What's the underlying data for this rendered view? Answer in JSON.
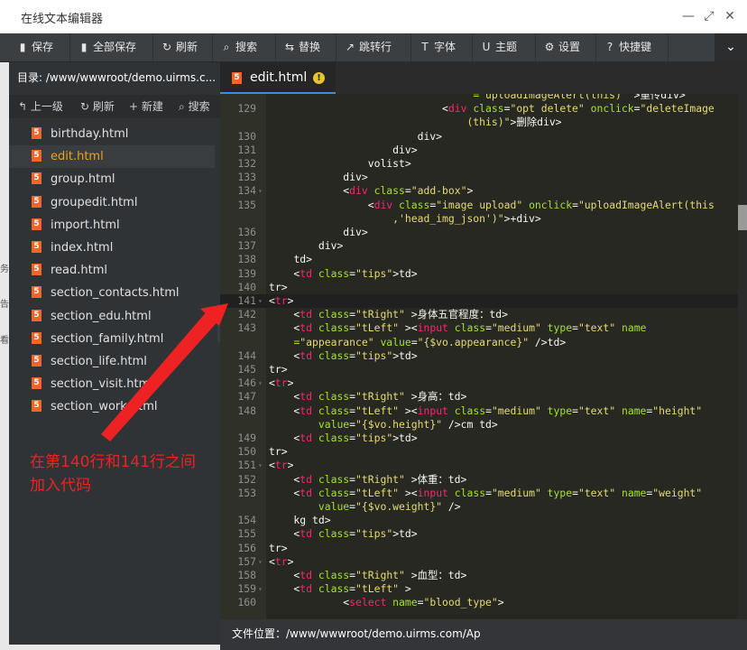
{
  "window": {
    "title": "在线文本编辑器",
    "minimize": "—",
    "maximize": "⤢",
    "close": "✕"
  },
  "toolbar": [
    {
      "label": "保存",
      "icon": "save-icon",
      "glyph": "▮"
    },
    {
      "label": "全部保存",
      "icon": "save-all-icon",
      "glyph": "▮"
    },
    {
      "label": "刷新",
      "icon": "refresh-icon",
      "glyph": "↻"
    },
    {
      "label": "搜索",
      "icon": "search-icon",
      "glyph": "⌕"
    },
    {
      "label": "替换",
      "icon": "replace-icon",
      "glyph": "⇆"
    },
    {
      "label": "跳转行",
      "icon": "goto-line-icon",
      "glyph": "↗"
    },
    {
      "label": "字体",
      "icon": "font-icon",
      "glyph": "T"
    },
    {
      "label": "主题",
      "icon": "theme-icon",
      "glyph": "U"
    },
    {
      "label": "设置",
      "icon": "settings-icon",
      "glyph": "⚙"
    },
    {
      "label": "快捷键",
      "icon": "shortcut-icon",
      "glyph": "?"
    }
  ],
  "toolbar_more": "⌄",
  "sidebar": {
    "directory": "目录: /www/wwwroot/demo.uirms.c...",
    "tools": [
      {
        "label": "上一级",
        "glyph": "↰"
      },
      {
        "label": "刷新",
        "glyph": "↻"
      },
      {
        "label": "新建",
        "glyph": "+"
      },
      {
        "label": "搜索",
        "glyph": "⌕"
      }
    ],
    "files": [
      "birthday.html",
      "edit.html",
      "group.html",
      "groupedit.html",
      "import.html",
      "index.html",
      "read.html",
      "section_contacts.html",
      "section_edu.html",
      "section_family.html",
      "section_life.html",
      "section_visit.html",
      "section_work.html"
    ],
    "active_file": "edit.html"
  },
  "editor": {
    "tab_name": "edit.html",
    "tab_warning": "!",
    "lines": [
      {
        "n": "",
        "fold": false,
        "html": "                                 <span class=\"a\">=</span><span class=\"s\">\"uploadImageAlert(this)\"</span> >重传</<span class=\"t\">div</span>>"
      },
      {
        "n": "129",
        "fold": false,
        "html": "                            <<span class=\"t\">div</span> <span class=\"a\">class</span>=<span class=\"s\">\"opt delete\"</span> <span class=\"a\">onclick</span>=<span class=\"s\">\"deleteImage</span>"
      },
      {
        "n": "",
        "fold": false,
        "html": "                                <span class=\"s\">(this)\"</span>>删除</<span class=\"t\">div</span>>"
      },
      {
        "n": "130",
        "fold": false,
        "html": "                        </<span class=\"t\">div</span>>"
      },
      {
        "n": "131",
        "fold": false,
        "html": "                    </<span class=\"t\">div</span>>"
      },
      {
        "n": "132",
        "fold": false,
        "html": "                </<span class=\"t\">volist</span>>"
      },
      {
        "n": "133",
        "fold": false,
        "html": "            </<span class=\"t\">div</span>>"
      },
      {
        "n": "134",
        "fold": true,
        "html": "            <<span class=\"t\">div</span> <span class=\"a\">class</span>=<span class=\"s\">\"add-box\"</span>>"
      },
      {
        "n": "135",
        "fold": false,
        "html": "                <<span class=\"t\">div</span> <span class=\"a\">class</span>=<span class=\"s\">\"image upload\"</span> <span class=\"a\">onclick</span>=<span class=\"s\">\"uploadImageAlert(this</span>"
      },
      {
        "n": "",
        "fold": false,
        "html": "                    <span class=\"s\">,'head_img_json')\"</span>>+</<span class=\"t\">div</span>>"
      },
      {
        "n": "136",
        "fold": false,
        "html": "            </<span class=\"t\">div</span>>"
      },
      {
        "n": "137",
        "fold": false,
        "html": "        </<span class=\"t\">div</span>>"
      },
      {
        "n": "138",
        "fold": false,
        "html": "    </<span class=\"t\">td</span>>"
      },
      {
        "n": "139",
        "fold": false,
        "html": "    <<span class=\"t\">td</span> <span class=\"a\">class</span>=<span class=\"s\">\"tips\"</span>></<span class=\"t\">td</span>>"
      },
      {
        "n": "140",
        "fold": false,
        "html": "</<span class=\"t\">tr</span>>"
      },
      {
        "n": "141",
        "fold": true,
        "cur": true,
        "html": "<<span class=\"t\">tr</span>>"
      },
      {
        "n": "142",
        "fold": false,
        "html": "    <<span class=\"t\">td</span> <span class=\"a\">class</span>=<span class=\"s\">\"tRight\"</span> >身体五官程度：</<span class=\"t\">td</span>>"
      },
      {
        "n": "143",
        "fold": false,
        "html": "    <<span class=\"t\">td</span> <span class=\"a\">class</span>=<span class=\"s\">\"tLeft\"</span> ><<span class=\"t\">input</span> <span class=\"a\">class</span>=<span class=\"s\">\"medium\"</span> <span class=\"a\">type</span>=<span class=\"s\">\"text\"</span> <span class=\"a\">name</span>"
      },
      {
        "n": "",
        "fold": false,
        "html": "    <span class=\"a\">=</span><span class=\"s\">\"appearance\"</span> <span class=\"a\">value</span>=<span class=\"s\">\"{$vo.appearance}\"</span> /></<span class=\"t\">td</span>>"
      },
      {
        "n": "144",
        "fold": false,
        "html": "    <<span class=\"t\">td</span> <span class=\"a\">class</span>=<span class=\"s\">\"tips\"</span>></<span class=\"t\">td</span>>"
      },
      {
        "n": "145",
        "fold": false,
        "html": "</<span class=\"t\">tr</span>>"
      },
      {
        "n": "146",
        "fold": true,
        "html": "<<span class=\"t\">tr</span>>"
      },
      {
        "n": "147",
        "fold": false,
        "html": "    <<span class=\"t\">td</span> <span class=\"a\">class</span>=<span class=\"s\">\"tRight\"</span> >身高：</<span class=\"t\">td</span>>"
      },
      {
        "n": "148",
        "fold": false,
        "html": "    <<span class=\"t\">td</span> <span class=\"a\">class</span>=<span class=\"s\">\"tLeft\"</span> ><<span class=\"t\">input</span> <span class=\"a\">class</span>=<span class=\"s\">\"medium\"</span> <span class=\"a\">type</span>=<span class=\"s\">\"text\"</span> <span class=\"a\">name</span>=<span class=\"s\">\"height\"</span>"
      },
      {
        "n": "",
        "fold": false,
        "html": "        <span class=\"a\">value</span>=<span class=\"s\">\"{$vo.height}\"</span> />cm </<span class=\"t\">td</span>>"
      },
      {
        "n": "149",
        "fold": false,
        "html": "    <<span class=\"t\">td</span> <span class=\"a\">class</span>=<span class=\"s\">\"tips\"</span>></<span class=\"t\">td</span>>"
      },
      {
        "n": "150",
        "fold": false,
        "html": "</<span class=\"t\">tr</span>>"
      },
      {
        "n": "151",
        "fold": true,
        "html": "<<span class=\"t\">tr</span>>"
      },
      {
        "n": "152",
        "fold": false,
        "html": "    <<span class=\"t\">td</span> <span class=\"a\">class</span>=<span class=\"s\">\"tRight\"</span> >体重：</<span class=\"t\">td</span>>"
      },
      {
        "n": "153",
        "fold": false,
        "html": "    <<span class=\"t\">td</span> <span class=\"a\">class</span>=<span class=\"s\">\"tLeft\"</span> ><<span class=\"t\">input</span> <span class=\"a\">class</span>=<span class=\"s\">\"medium\"</span> <span class=\"a\">type</span>=<span class=\"s\">\"text\"</span> <span class=\"a\">name</span>=<span class=\"s\">\"weight\"</span>"
      },
      {
        "n": "",
        "fold": false,
        "html": "        <span class=\"a\">value</span>=<span class=\"s\">\"{$vo.weight}\"</span> />"
      },
      {
        "n": "154",
        "fold": false,
        "html": "    kg </<span class=\"t\">td</span>>"
      },
      {
        "n": "155",
        "fold": false,
        "html": "    <<span class=\"t\">td</span> <span class=\"a\">class</span>=<span class=\"s\">\"tips\"</span>></<span class=\"t\">td</span>>"
      },
      {
        "n": "156",
        "fold": false,
        "html": "</<span class=\"t\">tr</span>>"
      },
      {
        "n": "157",
        "fold": true,
        "html": "<<span class=\"t\">tr</span>>"
      },
      {
        "n": "158",
        "fold": false,
        "html": "    <<span class=\"t\">td</span> <span class=\"a\">class</span>=<span class=\"s\">\"tRight\"</span> >血型：</<span class=\"t\">td</span>>"
      },
      {
        "n": "159",
        "fold": true,
        "html": "    <<span class=\"t\">td</span> <span class=\"a\">class</span>=<span class=\"s\">\"tLeft\"</span> >"
      },
      {
        "n": "160",
        "fold": false,
        "html": "            <<span class=\"t\">select</span> <span class=\"a\">name</span>=<span class=\"s\">\"blood_type\"</span>>"
      }
    ]
  },
  "status": {
    "file_location": "文件位置：/www/wwwroot/demo.uirms.com/Ap"
  },
  "annotation": {
    "line1": "在第140行和141行之间",
    "line2": "加入代码"
  },
  "left_edge_chars": [
    "务",
    "告",
    "看"
  ],
  "colors": {
    "tag": "#f92672",
    "attr": "#a6e22e",
    "string": "#e6db74",
    "annotation": "#ee2222",
    "active_file": "#f0a020"
  }
}
